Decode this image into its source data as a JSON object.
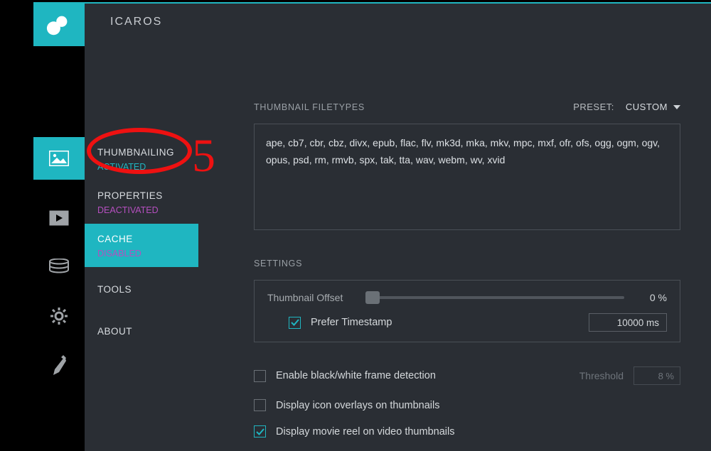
{
  "header": {
    "app_title": "ICAROS"
  },
  "sidebar": {
    "items": [
      {
        "label": "THUMBNAILING",
        "sub": "ACTIVATED"
      },
      {
        "label": "PROPERTIES",
        "sub": "DEACTIVATED"
      },
      {
        "label": "CACHE",
        "sub": "DISABLED"
      },
      {
        "label": "TOOLS",
        "sub": ""
      },
      {
        "label": "ABOUT",
        "sub": ""
      }
    ]
  },
  "main": {
    "filetypes_label": "THUMBNAIL FILETYPES",
    "preset_label": "PRESET:",
    "preset_value": "CUSTOM",
    "filetypes": "ape,  cb7,  cbr,  cbz,  divx,  epub,  flac,  flv,  mk3d,  mka,  mkv,  mpc,  mxf,  ofr,  ofs,  ogg,  ogm,  ogv,  opus,  psd,  rm,  rmvb,  spx,  tak,  tta,  wav,  webm,  wv,  xvid",
    "settings_label": "SETTINGS",
    "offset_label": "Thumbnail Offset",
    "offset_value": "0 %",
    "prefer_timestamp_label": "Prefer Timestamp",
    "timestamp_value": "10000 ms",
    "bw_label": "Enable black/white frame detection",
    "threshold_label": "Threshold",
    "threshold_value": "8 %",
    "overlay_label": "Display icon overlays on thumbnails",
    "reel_label": "Display movie reel on video thumbnails"
  },
  "bookmark_glyph": "+",
  "annotation_text": "5"
}
